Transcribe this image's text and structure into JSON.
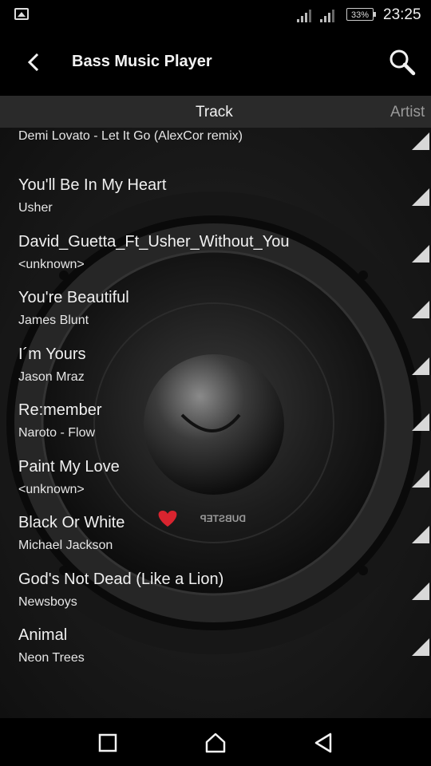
{
  "status_bar": {
    "icons": [
      "image-icon",
      "signal-icon",
      "signal-icon",
      "battery-icon"
    ],
    "battery": "33%",
    "time": "23:25"
  },
  "app_bar": {
    "title": "Bass Music Player",
    "icons": [
      "back-arrow-icon",
      "search-icon"
    ]
  },
  "tabs": [
    {
      "label": "Track",
      "selected": true
    },
    {
      "label": "Artist",
      "selected": false
    }
  ],
  "tracks": [
    {
      "title": "Demi Lovato - Let It Go (AlexCor remix)",
      "artist": ""
    },
    {
      "title": "You'll Be In My Heart",
      "artist": "Usher"
    },
    {
      "title": "David_Guetta_Ft_Usher_Without_You",
      "artist": "<unknown>"
    },
    {
      "title": "You're Beautiful",
      "artist": "James Blunt"
    },
    {
      "title": "I´m Yours",
      "artist": "Jason Mraz"
    },
    {
      "title": "Re:member",
      "artist": "Naroto - Flow"
    },
    {
      "title": "Paint My Love",
      "artist": "<unknown>"
    },
    {
      "title": "Black Or White",
      "artist": "Michael Jackson"
    },
    {
      "title": "God's Not Dead (Like a Lion)",
      "artist": "Newsboys"
    },
    {
      "title": "Animal",
      "artist": "Neon Trees"
    }
  ],
  "background": {
    "logo_text": "DUBSTEP"
  },
  "nav_bar": {
    "icons": [
      "recents-icon",
      "home-icon",
      "back-triangle-icon"
    ]
  },
  "colors": {
    "background": "#000000",
    "tab_bar": "#2a2a2a",
    "text": "#f0f0f0",
    "inactive_tab": "#9a9a9a"
  }
}
